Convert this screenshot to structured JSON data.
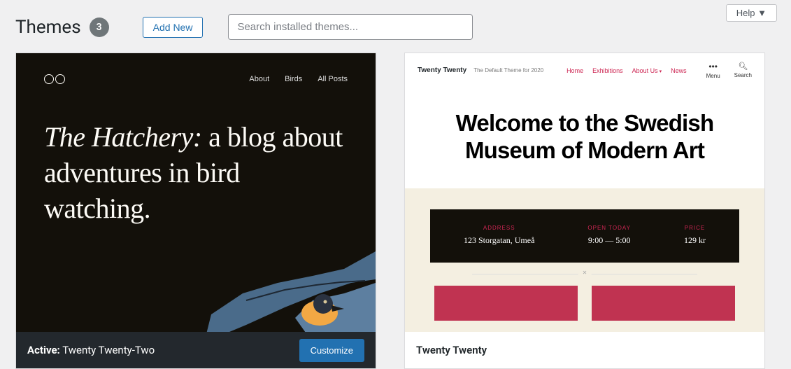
{
  "help_button": "Help",
  "page_title": "Themes",
  "theme_count": "3",
  "add_new_label": "Add New",
  "search_placeholder": "Search installed themes...",
  "active_theme": {
    "active_label": "Active:",
    "name": "Twenty Twenty-Two",
    "customize_label": "Customize",
    "preview": {
      "nav": [
        "About",
        "Birds",
        "All Posts"
      ],
      "headline_em": "The Hatchery:",
      "headline_rest": " a blog about adventures in bird watching."
    }
  },
  "inactive_theme": {
    "name": "Twenty Twenty",
    "preview": {
      "brand": "Twenty Twenty",
      "tagline": "The Default Theme for 2020",
      "menu": [
        "Home",
        "Exhibitions",
        "About Us",
        "News"
      ],
      "icons": {
        "menu": "Menu",
        "search": "Search"
      },
      "hero": "Welcome to the Swedish Museum of Modern Art",
      "info": {
        "address_label": "ADDRESS",
        "address": "123 Storgatan, Umeå",
        "open_label": "OPEN TODAY",
        "open": "9:00 — 5:00",
        "price_label": "PRICE",
        "price": "129 kr"
      }
    }
  }
}
